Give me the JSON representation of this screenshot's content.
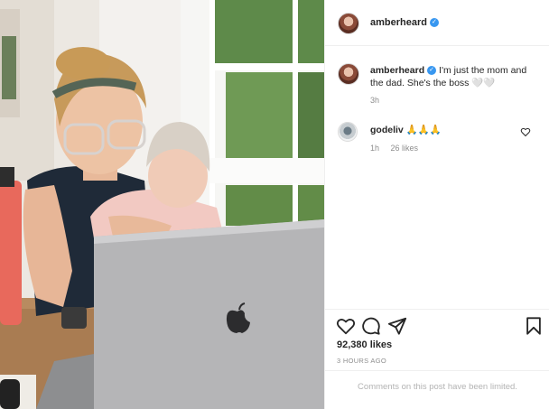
{
  "post": {
    "username": "amberheard",
    "verified_mark": "✓",
    "caption_text": "I'm just the mom and the dad. She's the boss 🤍🤍",
    "caption_age": "3h"
  },
  "comments": [
    {
      "username": "godeliv",
      "text": "🙏🙏🙏",
      "age": "1h",
      "likes": "26 likes"
    }
  ],
  "stats": {
    "likes": "92,380 likes",
    "posted": "3 HOURS AGO",
    "comments_limited": "Comments on this post have been limited."
  },
  "icons": {
    "like": "heart-icon",
    "comment": "comment-icon",
    "share": "send-icon",
    "save": "bookmark-icon"
  },
  "colors": {
    "verified": "#3897f0",
    "muted_text": "#8e8e8e",
    "bottle": "#e8695c"
  }
}
